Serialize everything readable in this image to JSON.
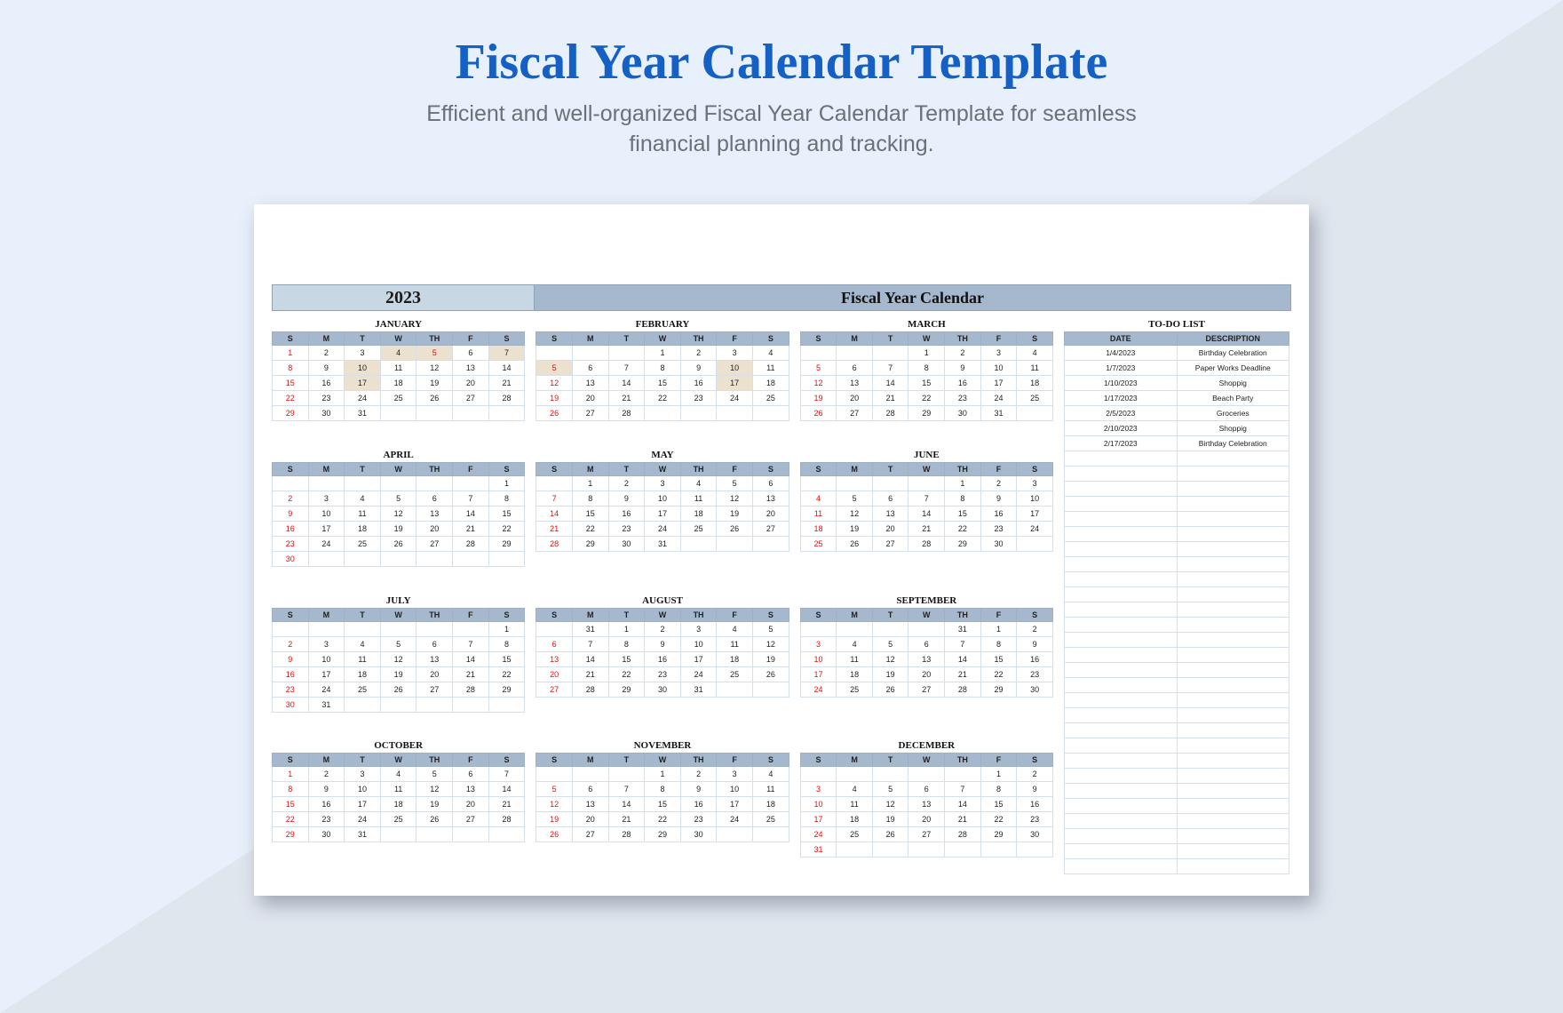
{
  "header": {
    "title": "Fiscal Year Calendar Template",
    "subtitle_l1": "Efficient and well-organized Fiscal Year Calendar Template for seamless",
    "subtitle_l2": "financial planning and tracking."
  },
  "sheet": {
    "year": "2023",
    "banner": "Fiscal Year Calendar",
    "dow": [
      "S",
      "M",
      "T",
      "W",
      "TH",
      "F",
      "S"
    ],
    "months": [
      {
        "name": "JANUARY",
        "start": 0,
        "days": 31,
        "hl": [
          4,
          7,
          10,
          17
        ],
        "hl_sun": [
          5
        ]
      },
      {
        "name": "FEBRUARY",
        "start": 3,
        "days": 28,
        "hl": [
          10,
          17
        ],
        "hl_sun": [
          5
        ]
      },
      {
        "name": "MARCH",
        "start": 3,
        "days": 31,
        "hl": [],
        "hl_sun": []
      },
      {
        "name": "APRIL",
        "start": 6,
        "days": 30,
        "hl": [],
        "hl_sun": []
      },
      {
        "name": "MAY",
        "start": 1,
        "days": 31,
        "hl": [],
        "hl_sun": []
      },
      {
        "name": "JUNE",
        "start": 4,
        "days": 30,
        "hl": [],
        "hl_sun": []
      },
      {
        "name": "JULY",
        "start": 6,
        "days": 31,
        "hl": [],
        "hl_sun": []
      },
      {
        "name": "AUGUST",
        "start": 2,
        "days": 31,
        "hl": [],
        "hl_sun": [],
        "pre": [
          31
        ]
      },
      {
        "name": "SEPTEMBER",
        "start": 5,
        "days": 30,
        "hl": [],
        "hl_sun": [],
        "pre": [
          31
        ]
      },
      {
        "name": "OCTOBER",
        "start": 0,
        "days": 31,
        "hl": [],
        "hl_sun": []
      },
      {
        "name": "NOVEMBER",
        "start": 3,
        "days": 30,
        "hl": [],
        "hl_sun": []
      },
      {
        "name": "DECEMBER",
        "start": 5,
        "days": 31,
        "hl": [],
        "hl_sun": []
      }
    ],
    "todo": {
      "title": "TO-DO LIST",
      "cols": [
        "DATE",
        "DESCRIPTION"
      ],
      "rows": [
        {
          "d": "1/4/2023",
          "t": "Birthday Celebration"
        },
        {
          "d": "1/7/2023",
          "t": "Paper Works Deadline"
        },
        {
          "d": "1/10/2023",
          "t": "Shoppig"
        },
        {
          "d": "1/17/2023",
          "t": "Beach Party"
        },
        {
          "d": "2/5/2023",
          "t": "Groceries"
        },
        {
          "d": "2/10/2023",
          "t": "Shoppig"
        },
        {
          "d": "2/17/2023",
          "t": "Birthday Celebration"
        }
      ],
      "blank_rows": 28
    }
  }
}
